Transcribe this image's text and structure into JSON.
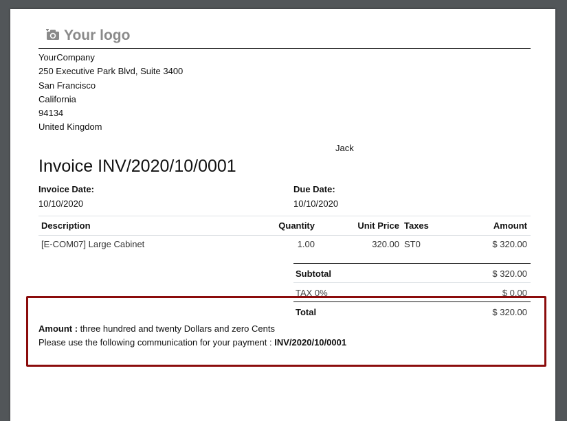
{
  "logo": {
    "icon": "camera-icon",
    "text": "Your logo"
  },
  "company": {
    "name": "YourCompany",
    "street": "250 Executive Park Blvd, Suite 3400",
    "city": "San Francisco",
    "state": "California",
    "zip": "94134",
    "country": "United Kingdom"
  },
  "partner": {
    "name": "Jack"
  },
  "invoice": {
    "title": "Invoice INV/2020/10/0001",
    "date_label": "Invoice Date:",
    "date": "10/10/2020",
    "due_label": "Due Date:",
    "due": "10/10/2020"
  },
  "table": {
    "headers": {
      "description": "Description",
      "quantity": "Quantity",
      "unit_price": "Unit Price",
      "taxes": "Taxes",
      "amount": "Amount"
    },
    "rows": [
      {
        "description": "[E-COM07] Large Cabinet",
        "quantity": "1.00",
        "unit_price": "320.00",
        "taxes": "ST0",
        "amount": "$ 320.00"
      }
    ]
  },
  "totals": {
    "subtotal_label": "Subtotal",
    "subtotal": "$ 320.00",
    "tax_label": "TAX 0%",
    "tax": "$ 0.00",
    "total_label": "Total",
    "total": "$ 320.00"
  },
  "footer": {
    "amount_label": "Amount :",
    "amount_text": "three hundred and twenty Dollars and zero Cents",
    "communication_text": "Please use the following communication for your payment :",
    "communication_ref": "INV/2020/10/0001"
  },
  "colors": {
    "highlight_border": "#8b0c0c",
    "logo_gray": "#8a8a8a",
    "viewer_background": "#525659"
  }
}
